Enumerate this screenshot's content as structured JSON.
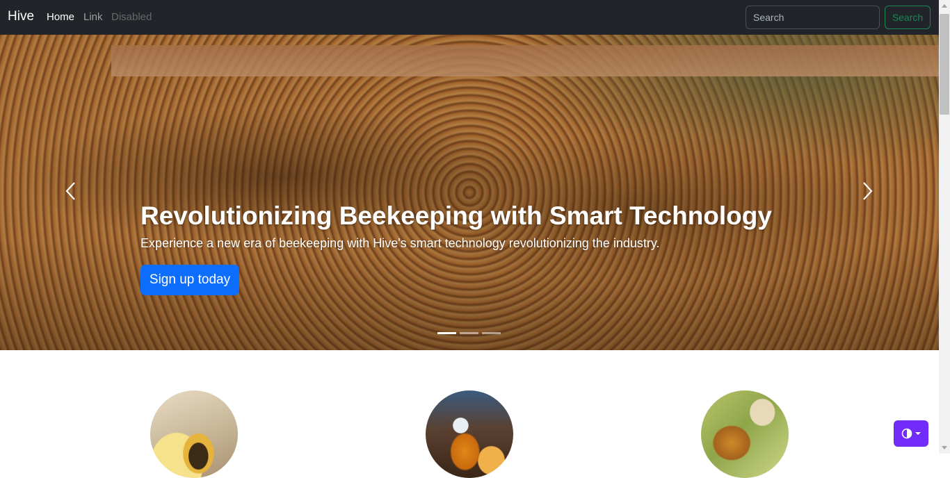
{
  "navbar": {
    "brand": "Hive",
    "links": [
      {
        "label": "Home",
        "active": true
      },
      {
        "label": "Link"
      },
      {
        "label": "Disabled",
        "disabled": true
      }
    ],
    "search_placeholder": "Search",
    "search_button": "Search",
    "background": "#212529",
    "search_button_color": "#198754"
  },
  "hero": {
    "title": "Revolutionizing Beekeeping with Smart Technology",
    "text": "Experience a new era of beekeeping with Hive's smart technology revolutionizing the industry.",
    "cta_label": "Sign up today",
    "cta_color": "#0d6efd",
    "indicator_count": 3,
    "active_indicator": 1,
    "prev_icon": "chevron-left-icon",
    "next_icon": "chevron-right-icon"
  },
  "features": [
    {
      "image": "bee-on-flower"
    },
    {
      "image": "honey-jar"
    },
    {
      "image": "beekeeper-with-frame"
    }
  ],
  "theme_toggle": {
    "icon": "contrast-icon",
    "color": "#712cf9"
  }
}
